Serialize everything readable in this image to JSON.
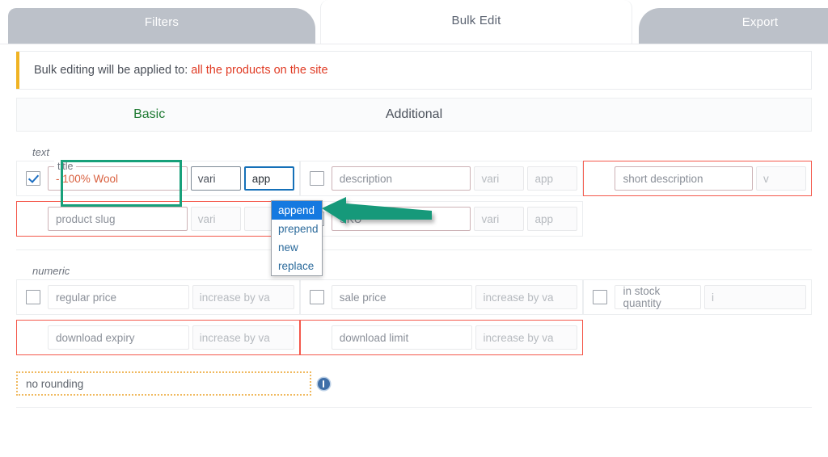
{
  "tabs": [
    {
      "label": "Filters",
      "active": false
    },
    {
      "label": "Bulk Edit",
      "active": true
    },
    {
      "label": "Export",
      "active": false
    }
  ],
  "notice": {
    "text": "Bulk editing will be applied to:",
    "target": "all the products on the site",
    "accent_color": "#f0b323",
    "target_color": "#e03b24"
  },
  "column_headers": [
    {
      "label": "Basic",
      "color": "#1f7a33"
    },
    {
      "label": "Additional",
      "color": "#4c525c"
    },
    {
      "label": "",
      "color": "#4c525c"
    }
  ],
  "groups": [
    {
      "name": "text"
    },
    {
      "name": "numeric"
    }
  ],
  "text_fields": {
    "row1": [
      {
        "label": "title",
        "placeholder": "title",
        "value": "- 100% Wool",
        "checkbox": true,
        "checked": true,
        "sub1": "vari",
        "sub2": "app",
        "highlighted": true,
        "red": false
      },
      {
        "label": "description",
        "placeholder": "description",
        "value": "",
        "checkbox": true,
        "checked": false,
        "sub1": "vari",
        "sub2": "app",
        "highlighted": false,
        "red": false
      },
      {
        "label": "short description",
        "placeholder": "short description",
        "value": "",
        "checkbox": false,
        "checked": false,
        "sub1": "v",
        "sub2": "",
        "highlighted": false,
        "red": true
      }
    ],
    "row2": [
      {
        "label": "product slug",
        "placeholder": "product slug",
        "value": "",
        "checkbox": false,
        "checked": false,
        "sub1": "vari",
        "sub2": "",
        "highlighted": false,
        "red": true
      },
      {
        "label": "SKU",
        "placeholder": "SKU",
        "value": "",
        "checkbox": true,
        "checked": false,
        "sub1": "vari",
        "sub2": "app",
        "highlighted": false,
        "red": false
      },
      {
        "label": "",
        "placeholder": "",
        "value": "",
        "checkbox": false,
        "checked": false,
        "sub1": "",
        "sub2": "",
        "highlighted": false,
        "red": false
      }
    ]
  },
  "numeric_fields": {
    "row1": [
      {
        "placeholder": "regular price",
        "checkbox": true,
        "checked": false,
        "sub1": "increase by va",
        "red": false
      },
      {
        "placeholder": "sale price",
        "checkbox": true,
        "checked": false,
        "sub1": "increase by va",
        "red": false
      },
      {
        "placeholder": "in stock quantity",
        "checkbox": true,
        "checked": false,
        "sub1": "i",
        "red": false
      }
    ],
    "row2": [
      {
        "placeholder": "download expiry",
        "checkbox": false,
        "checked": false,
        "sub1": "increase by va",
        "red": true
      },
      {
        "placeholder": "download limit",
        "checkbox": false,
        "checked": false,
        "sub1": "increase by va",
        "red": true
      },
      {
        "placeholder": "",
        "checkbox": false,
        "checked": false,
        "sub1": "",
        "red": false
      }
    ]
  },
  "dropdown": {
    "trigger_value": "app",
    "options": [
      {
        "label": "append",
        "selected": true
      },
      {
        "label": "prepend",
        "selected": false
      },
      {
        "label": "new",
        "selected": false
      },
      {
        "label": "replace",
        "selected": false
      }
    ]
  },
  "rounding": {
    "value": "no rounding",
    "info_icon": "info-icon",
    "border_color": "#f0b95e"
  },
  "annotations": {
    "arrow": {
      "name": "arrow-pointer",
      "color": "#15997a",
      "direction": "left"
    },
    "highlight_box": {
      "name": "title-field-highlight",
      "color": "#18a07a"
    }
  }
}
